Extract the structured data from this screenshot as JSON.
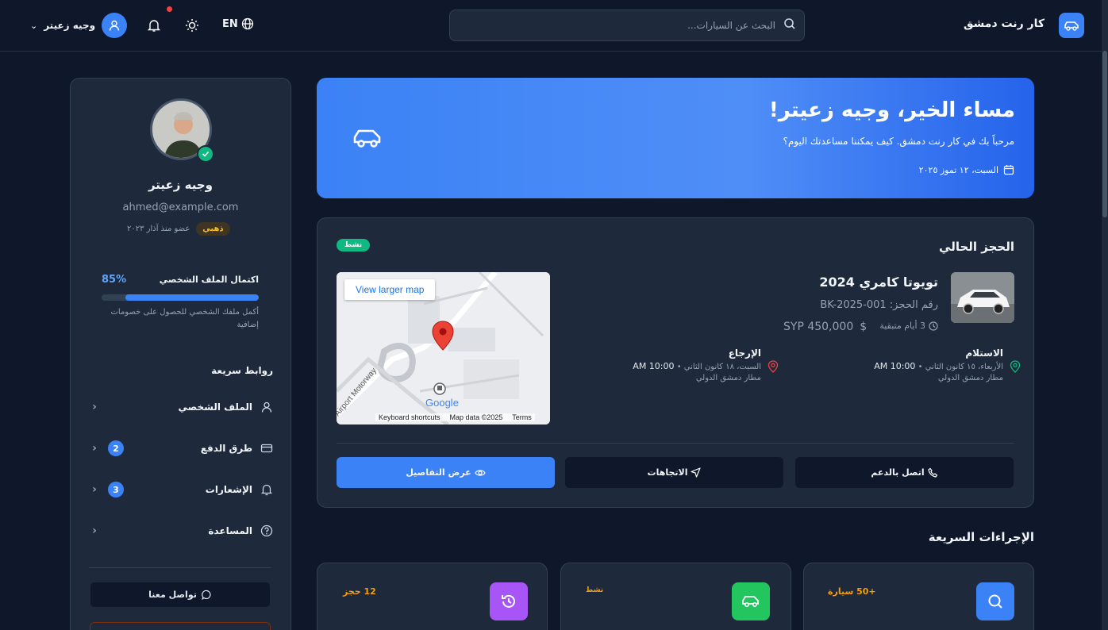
{
  "header": {
    "brand": "كار رنت دمشق",
    "search_placeholder": "البحث عن السيارات...",
    "lang": "EN",
    "user_name": "وجيه زعيتر"
  },
  "profile": {
    "name": "وجيه زعيتر",
    "email": "ahmed@example.com",
    "tier": "ذهبي",
    "member_since": "عضو منذ آذار ٢٠٢٣",
    "completion_label": "اكتمال الملف الشخصي",
    "completion_pct": "85%",
    "completion_value": 0.85,
    "hint": "أكمل ملفك الشخصي للحصول على خصومات إضافية"
  },
  "quick_links": {
    "title": "روابط سريعة",
    "items": [
      {
        "label": "الملف الشخصي",
        "icon": "user-icon"
      },
      {
        "label": "طرق الدفع",
        "icon": "card-icon",
        "badge": "2"
      },
      {
        "label": "الإشعارات",
        "icon": "bell-icon",
        "badge": "3"
      },
      {
        "label": "المساعدة",
        "icon": "help-icon"
      }
    ],
    "contact": "تواصل معنا"
  },
  "hero": {
    "title": "مساء الخير، وجيه زعيتر!",
    "subtitle": "مرحباً بك في كار رنت دمشق. كيف يمكننا مساعدتك اليوم؟",
    "date": "السبت، ١٢ تموز ٢٠٢٥"
  },
  "booking": {
    "title": "الحجز الحالي",
    "status": "نشط",
    "car": "تويوتا كامري 2024",
    "number": "رقم الحجز: BK-2025-001",
    "days": "3 أيام متبقية",
    "price": "SYP 450,000",
    "map_button": "View larger map",
    "map_shortcuts": "Keyboard shortcuts",
    "map_data": "Map data ©2025",
    "map_terms": "Terms",
    "map_road": "Airport Motorway",
    "map_logo": "Google",
    "pickup": {
      "title": "الاستلام",
      "date": "الأربعاء، ١٥ كانون الثاني •",
      "time": "AM 10:00",
      "place": "مطار دمشق الدولي"
    },
    "return": {
      "title": "الإرجاع",
      "date": "السبت، ١٨ كانون الثاني •",
      "time": "AM 10:00",
      "place": "مطار دمشق الدولي"
    },
    "actions": {
      "support": "اتصل بالدعم",
      "directions": "الاتجاهات",
      "details": "عرض التفاصيل"
    }
  },
  "quick_actions": {
    "title": "الإجراءات السريعة",
    "cards": [
      {
        "meta": "+50 سيارة",
        "icon": "search-icon",
        "color": "#3b82f6"
      },
      {
        "meta": "نشط",
        "icon": "car-icon",
        "color": "#22c55e"
      },
      {
        "meta": "12 حجز",
        "icon": "history-icon",
        "color": "#a855f7"
      }
    ]
  },
  "colors": {
    "accent": "#3b82f6",
    "success": "#10b981",
    "warning": "#f59e0b"
  }
}
